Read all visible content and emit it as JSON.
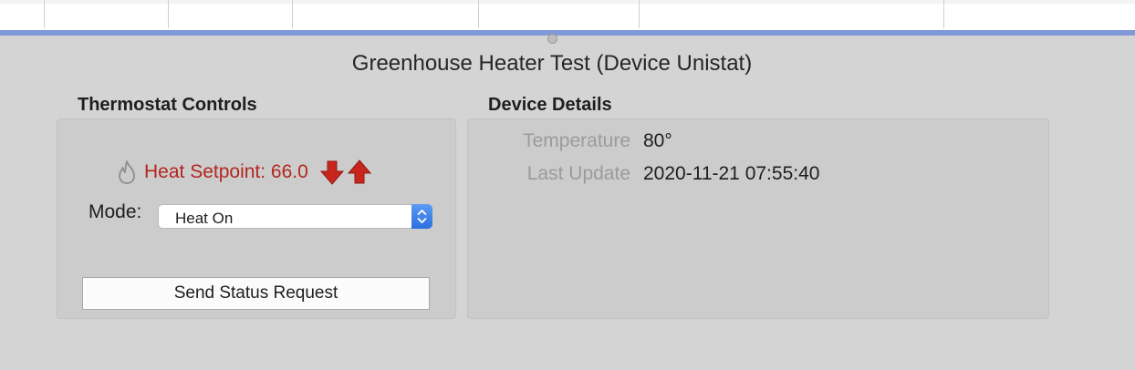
{
  "window": {
    "title": "Greenhouse Heater Test (Device Unistat)"
  },
  "thermostat": {
    "section_title": "Thermostat Controls",
    "setpoint_label": "Heat Setpoint: 66.0",
    "mode_label": "Mode:",
    "mode_selected": "Heat On",
    "send_button_label": "Send Status Request",
    "icons": {
      "flame": "flame-icon",
      "decrease": "arrow-down-icon",
      "increase": "arrow-up-icon",
      "stepper": "select-stepper-icon"
    },
    "colors": {
      "setpoint_text": "#b3261e",
      "arrow": "#c8261c",
      "stepper": "#3b7ff0"
    }
  },
  "details": {
    "section_title": "Device Details",
    "rows": [
      {
        "label": "Temperature",
        "value": "80°"
      },
      {
        "label": "Last Update",
        "value": "2020-11-21 07:55:40"
      }
    ]
  },
  "colors": {
    "split_bar": "#7f99d8",
    "background": "#d4d4d4"
  }
}
